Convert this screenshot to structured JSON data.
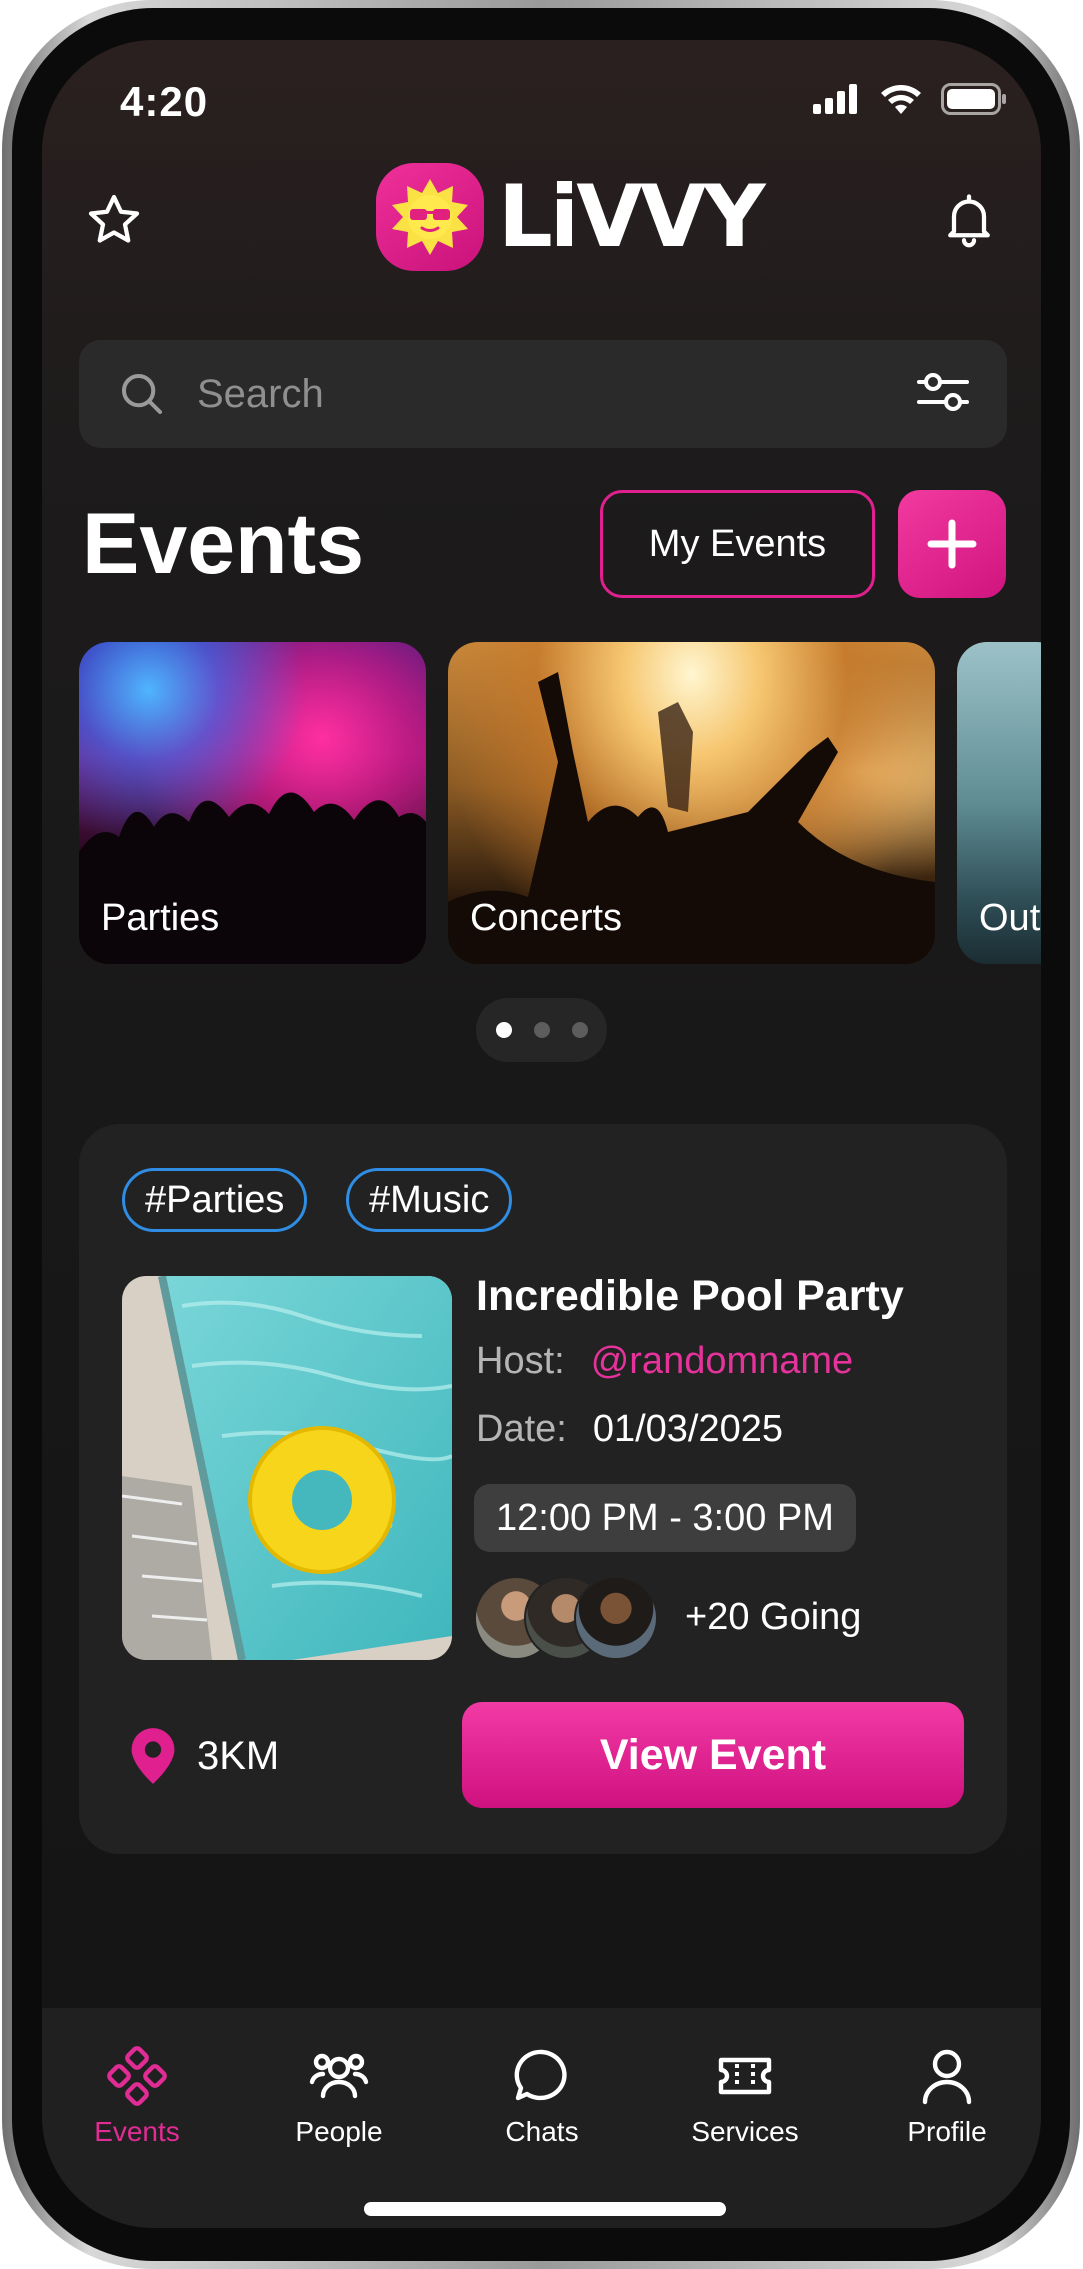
{
  "status": {
    "time": "4:20"
  },
  "header": {
    "logo_text": "LiVVY",
    "star_icon": "star-icon",
    "bell_icon": "bell-icon"
  },
  "search": {
    "placeholder": "Search"
  },
  "events": {
    "title": "Events",
    "my_events_label": "My Events",
    "add_label": "+"
  },
  "categories": [
    {
      "label": "Parties"
    },
    {
      "label": "Concerts"
    },
    {
      "label": "Out"
    }
  ],
  "pager": {
    "count": 3,
    "active": 0
  },
  "event_card": {
    "tags": [
      "#Parties",
      "#Music"
    ],
    "title": "Incredible Pool Party",
    "host_label": "Host:",
    "host_value": "@randomname",
    "date_label": "Date:",
    "date_value": "01/03/2025",
    "time_range": "12:00 PM - 3:00 PM",
    "going": "+20 Going",
    "distance": "3KM",
    "view_button": "View Event"
  },
  "tabbar": {
    "items": [
      {
        "label": "Events",
        "icon": "events-icon",
        "active": true
      },
      {
        "label": "People",
        "icon": "people-icon",
        "active": false
      },
      {
        "label": "Chats",
        "icon": "chat-icon",
        "active": false
      },
      {
        "label": "Services",
        "icon": "ticket-icon",
        "active": false
      },
      {
        "label": "Profile",
        "icon": "profile-icon",
        "active": false
      }
    ]
  },
  "colors": {
    "accent": "#E0208F",
    "tag_border": "#2F8DE4",
    "background": "#171717",
    "card": "#222222"
  }
}
